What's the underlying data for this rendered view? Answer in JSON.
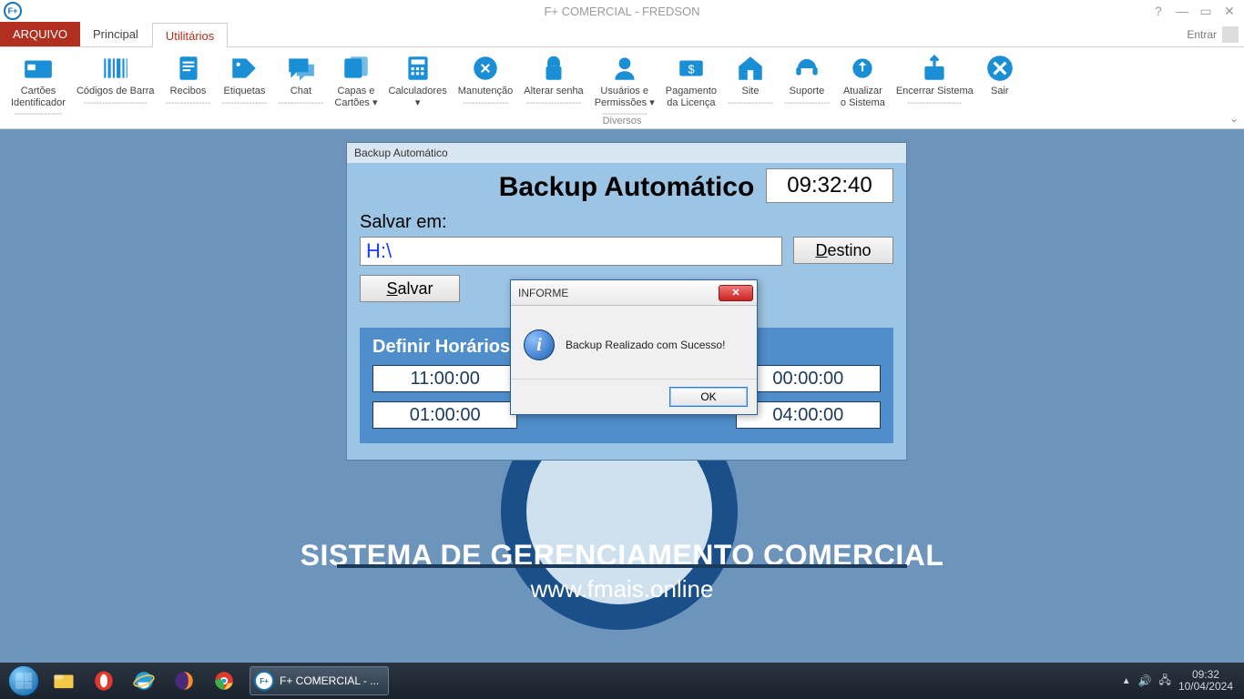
{
  "window": {
    "title": "F+ COMERCIAL - FREDSON",
    "entrar": "Entrar"
  },
  "tabs": {
    "file": "ARQUIVO",
    "principal": "Principal",
    "utilitarios": "Utilitários"
  },
  "ribbon": {
    "group": "Diversos",
    "items": [
      {
        "label": "Cartões\nIdentificador",
        "dashes": "----------------"
      },
      {
        "label": "Códigos de Barra",
        "dashes": "---------------------"
      },
      {
        "label": "Recibos",
        "dashes": "---------------"
      },
      {
        "label": "Etiquetas",
        "dashes": "---------------"
      },
      {
        "label": "Chat",
        "dashes": "---------------"
      },
      {
        "label": "Capas e\nCartões ▾",
        "dashes": ""
      },
      {
        "label": "Calculadores\n▾",
        "dashes": ""
      },
      {
        "label": "Manutenção",
        "dashes": "---------------"
      },
      {
        "label": "Alterar senha",
        "dashes": "------------------"
      },
      {
        "label": "Usuários e\nPermissões ▾",
        "dashes": "---------------"
      },
      {
        "label": "Pagamento\nda Licença",
        "dashes": ""
      },
      {
        "label": "Site",
        "dashes": "---------------"
      },
      {
        "label": "Suporte",
        "dashes": "---------------"
      },
      {
        "label": "Atualizar\no Sistema",
        "dashes": ""
      },
      {
        "label": "Encerrar Sistema",
        "dashes": "------------------"
      },
      {
        "label": "Sair",
        "dashes": ""
      }
    ]
  },
  "brand": {
    "title": "SISTEMA DE GERENCIAMENTO COMERCIAL",
    "url": "www.fmais.online"
  },
  "backup": {
    "win_title": "Backup Automático",
    "heading": "Backup Automático",
    "clock": "09:32:40",
    "save_label": "Salvar em:",
    "path": "H:\\",
    "dest_btn": "Destino",
    "save_btn": "Salvar",
    "section_title": "Definir Horários Para Backup",
    "times": [
      "11:00:00",
      "",
      "00:00:00",
      "01:00:00",
      "",
      "04:00:00"
    ]
  },
  "dialog": {
    "title": "INFORME",
    "message": "Backup Realizado com Sucesso!",
    "ok": "OK"
  },
  "taskbar": {
    "app": "F+ COMERCIAL - ...",
    "time": "09:32",
    "date": "10/04/2024"
  }
}
